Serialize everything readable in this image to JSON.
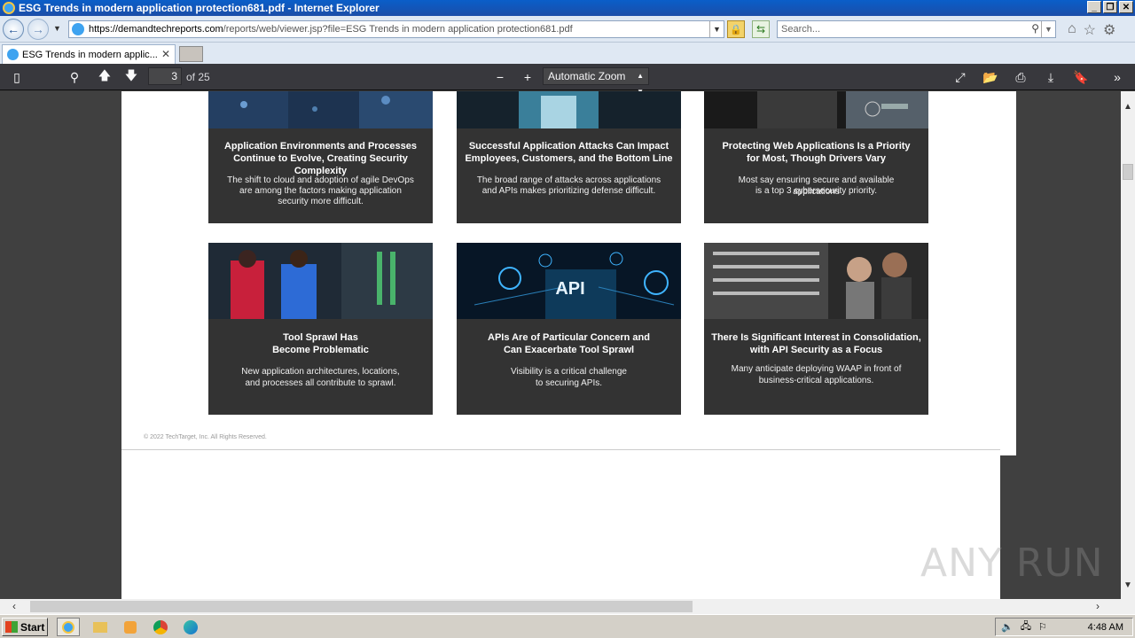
{
  "window": {
    "title": "ESG Trends in modern application protection681.pdf - Internet Explorer"
  },
  "address_bar": {
    "url_host": "https://demandtechreports.com",
    "url_path": "/reports/web/viewer.jsp?file=ESG Trends in modern application protection681.pdf",
    "search_placeholder": "Search..."
  },
  "tab": {
    "label": "ESG Trends in modern applic..."
  },
  "pdf_toolbar": {
    "page_number": "3",
    "page_count": "of 25",
    "zoom": "Automatic Zoom"
  },
  "cards": [
    {
      "title1": "Application Environments and Processes",
      "title2": "Continue to Evolve, Creating Security Complexity",
      "desc1": "The shift to cloud and adoption of agile DevOps",
      "desc2": "are among the factors making application",
      "desc3": "security more difficult."
    },
    {
      "title1": "Successful Application Attacks Can Impact",
      "title2": "Employees, Customers, and the Bottom Line",
      "desc1": "The broad range of attacks across applications",
      "desc2": "and APIs makes prioritizing defense difficult.",
      "desc3": ""
    },
    {
      "title1": "Protecting Web Applications Is a Priority",
      "title2": "for Most, Though Drivers Vary",
      "desc1": "Most say ensuring secure and available applications",
      "desc2": "is a top 3 cybersecurity priority.",
      "desc3": ""
    },
    {
      "title1": "Tool Sprawl Has",
      "title2": "Become Problematic",
      "desc1": "New application architectures, locations,",
      "desc2": "and processes all contribute to sprawl.",
      "desc3": ""
    },
    {
      "title1": "APIs Are of Particular Concern and",
      "title2": "Can Exacerbate Tool Sprawl",
      "desc1": "Visibility is a critical challenge",
      "desc2": "to securing APIs.",
      "desc3": ""
    },
    {
      "title1": "There Is Significant Interest in Consolidation,",
      "title2": "with API Security as a Focus",
      "desc1": "Many anticipate deploying WAAP in front of",
      "desc2": "business-critical applications.",
      "desc3": ""
    }
  ],
  "api_image_text": "API",
  "copyright": "© 2022 TechTarget, Inc. All Rights Reserved.",
  "taskbar": {
    "start_label": "Start",
    "clock": "4:48 AM"
  },
  "watermark": "ANY RUN"
}
